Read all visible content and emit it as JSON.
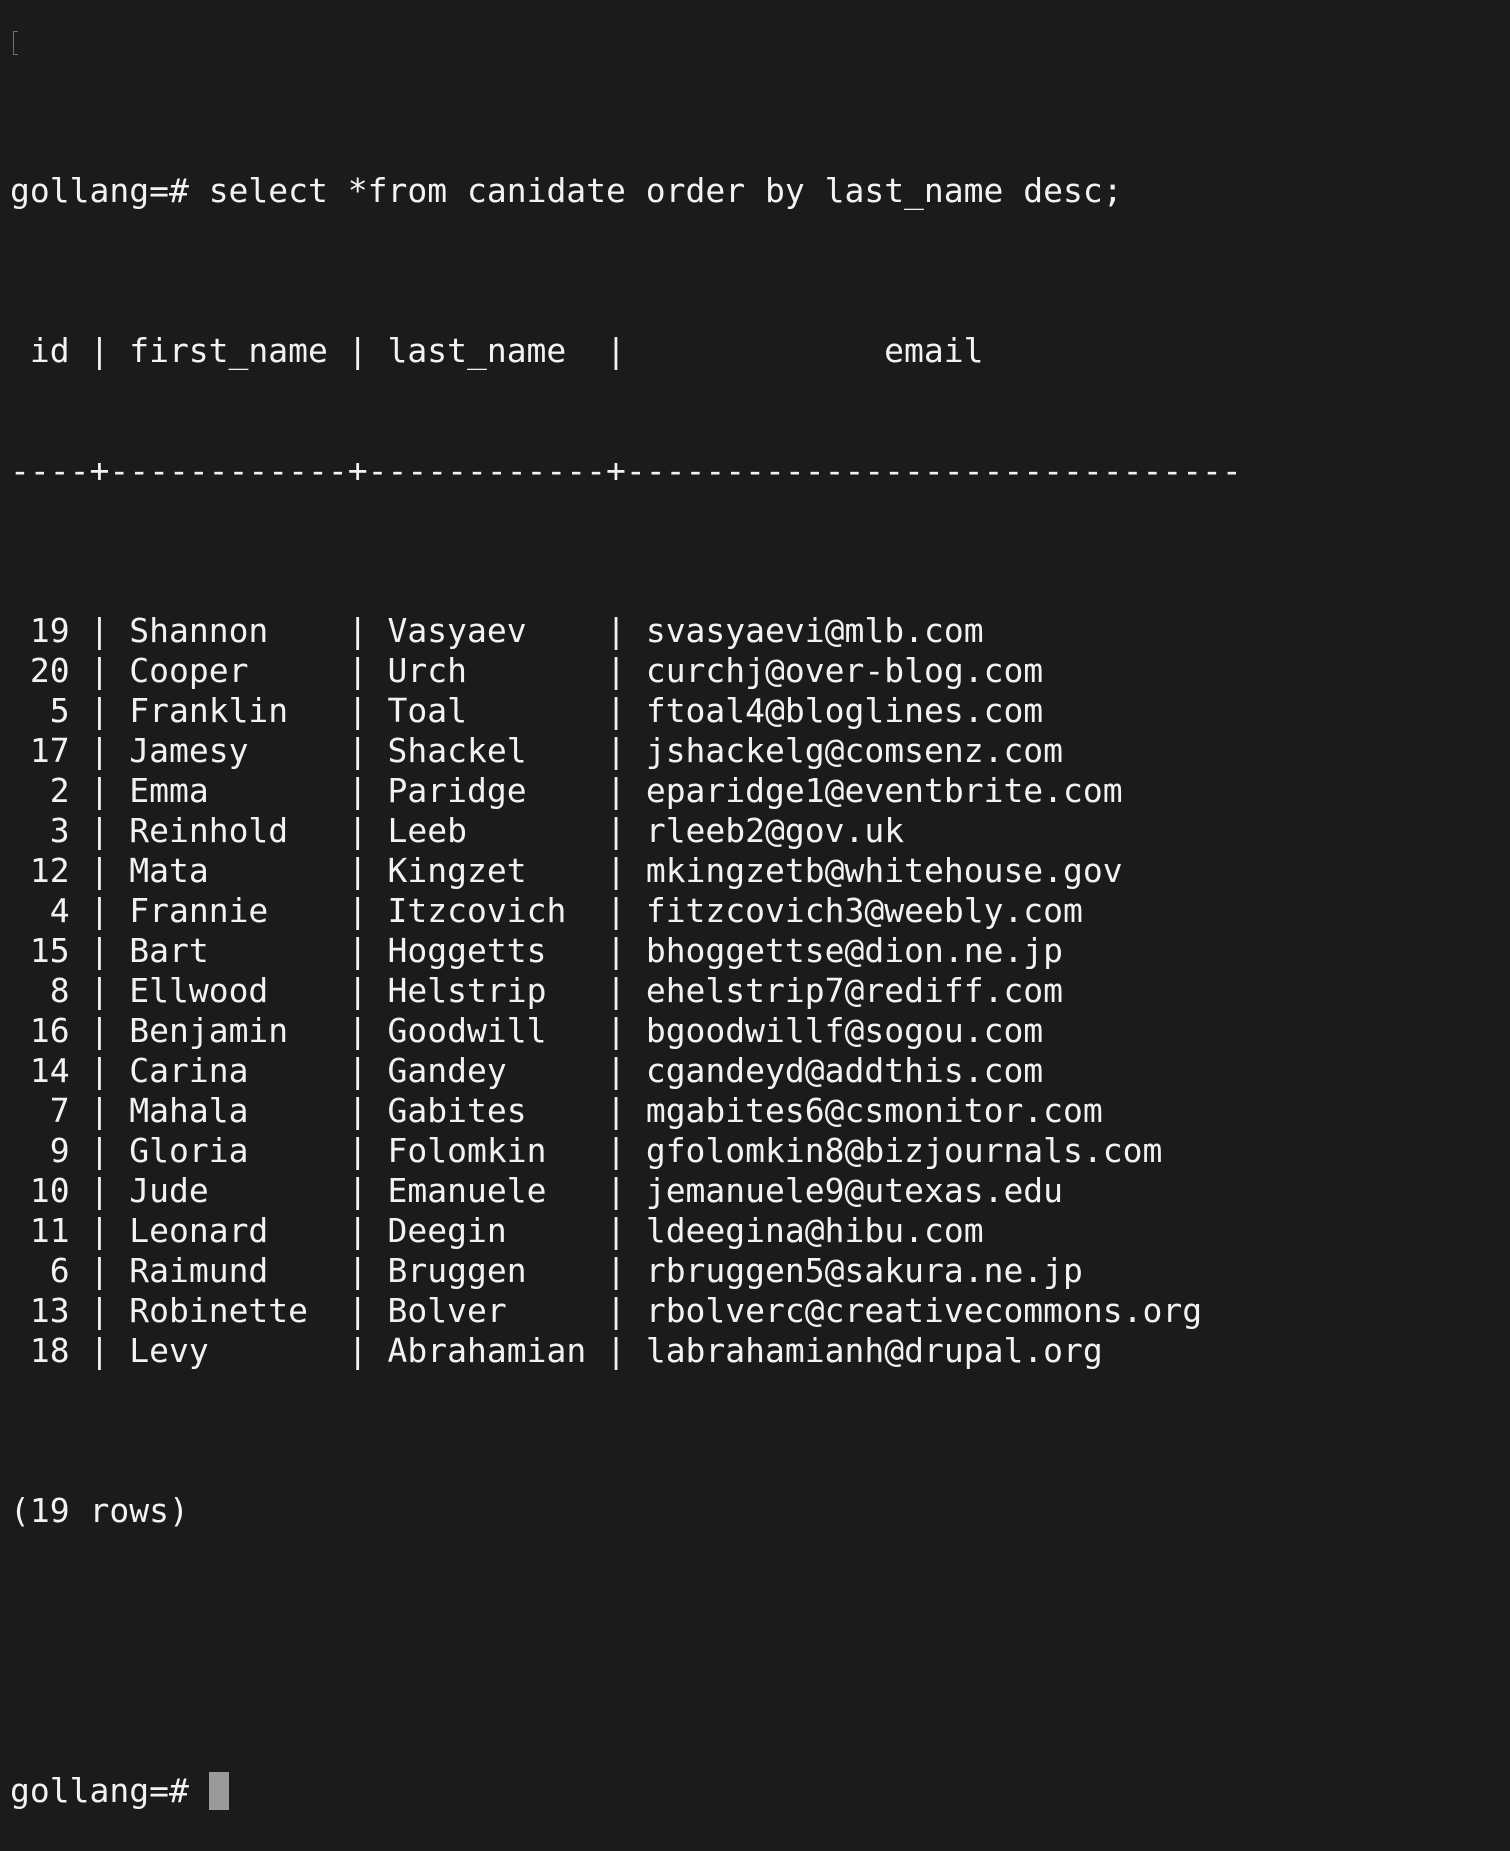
{
  "terminal": {
    "prompt": "gollang=# ",
    "command": "select *from canidate order by last_name desc;",
    "header": " id | first_name | last_name  |             email",
    "separator": "----+------------+------------+-------------------------------",
    "rows": [
      {
        "id": "19",
        "first_name": "Shannon",
        "last_name": "Vasyaev",
        "email": "svasyaevi@mlb.com"
      },
      {
        "id": "20",
        "first_name": "Cooper",
        "last_name": "Urch",
        "email": "curchj@over-blog.com"
      },
      {
        "id": "5",
        "first_name": "Franklin",
        "last_name": "Toal",
        "email": "ftoal4@bloglines.com"
      },
      {
        "id": "17",
        "first_name": "Jamesy",
        "last_name": "Shackel",
        "email": "jshackelg@comsenz.com"
      },
      {
        "id": "2",
        "first_name": "Emma",
        "last_name": "Paridge",
        "email": "eparidge1@eventbrite.com"
      },
      {
        "id": "3",
        "first_name": "Reinhold",
        "last_name": "Leeb",
        "email": "rleeb2@gov.uk"
      },
      {
        "id": "12",
        "first_name": "Mata",
        "last_name": "Kingzet",
        "email": "mkingzetb@whitehouse.gov"
      },
      {
        "id": "4",
        "first_name": "Frannie",
        "last_name": "Itzcovich",
        "email": "fitzcovich3@weebly.com"
      },
      {
        "id": "15",
        "first_name": "Bart",
        "last_name": "Hoggetts",
        "email": "bhoggettse@dion.ne.jp"
      },
      {
        "id": "8",
        "first_name": "Ellwood",
        "last_name": "Helstrip",
        "email": "ehelstrip7@rediff.com"
      },
      {
        "id": "16",
        "first_name": "Benjamin",
        "last_name": "Goodwill",
        "email": "bgoodwillf@sogou.com"
      },
      {
        "id": "14",
        "first_name": "Carina",
        "last_name": "Gandey",
        "email": "cgandeyd@addthis.com"
      },
      {
        "id": "7",
        "first_name": "Mahala",
        "last_name": "Gabites",
        "email": "mgabites6@csmonitor.com"
      },
      {
        "id": "9",
        "first_name": "Gloria",
        "last_name": "Folomkin",
        "email": "gfolomkin8@bizjournals.com"
      },
      {
        "id": "10",
        "first_name": "Jude",
        "last_name": "Emanuele",
        "email": "jemanuele9@utexas.edu"
      },
      {
        "id": "11",
        "first_name": "Leonard",
        "last_name": "Deegin",
        "email": "ldeegina@hibu.com"
      },
      {
        "id": "6",
        "first_name": "Raimund",
        "last_name": "Bruggen",
        "email": "rbruggen5@sakura.ne.jp"
      },
      {
        "id": "13",
        "first_name": "Robinette",
        "last_name": "Bolver",
        "email": "rbolverc@creativecommons.org"
      },
      {
        "id": "18",
        "first_name": "Levy",
        "last_name": "Abrahamian",
        "email": "labrahamianh@drupal.org"
      }
    ],
    "footer": "(19 rows)",
    "colors": {
      "background": "#1b1b1b",
      "foreground": "#f2f2f2",
      "cursor": "#9a9a9a"
    }
  }
}
